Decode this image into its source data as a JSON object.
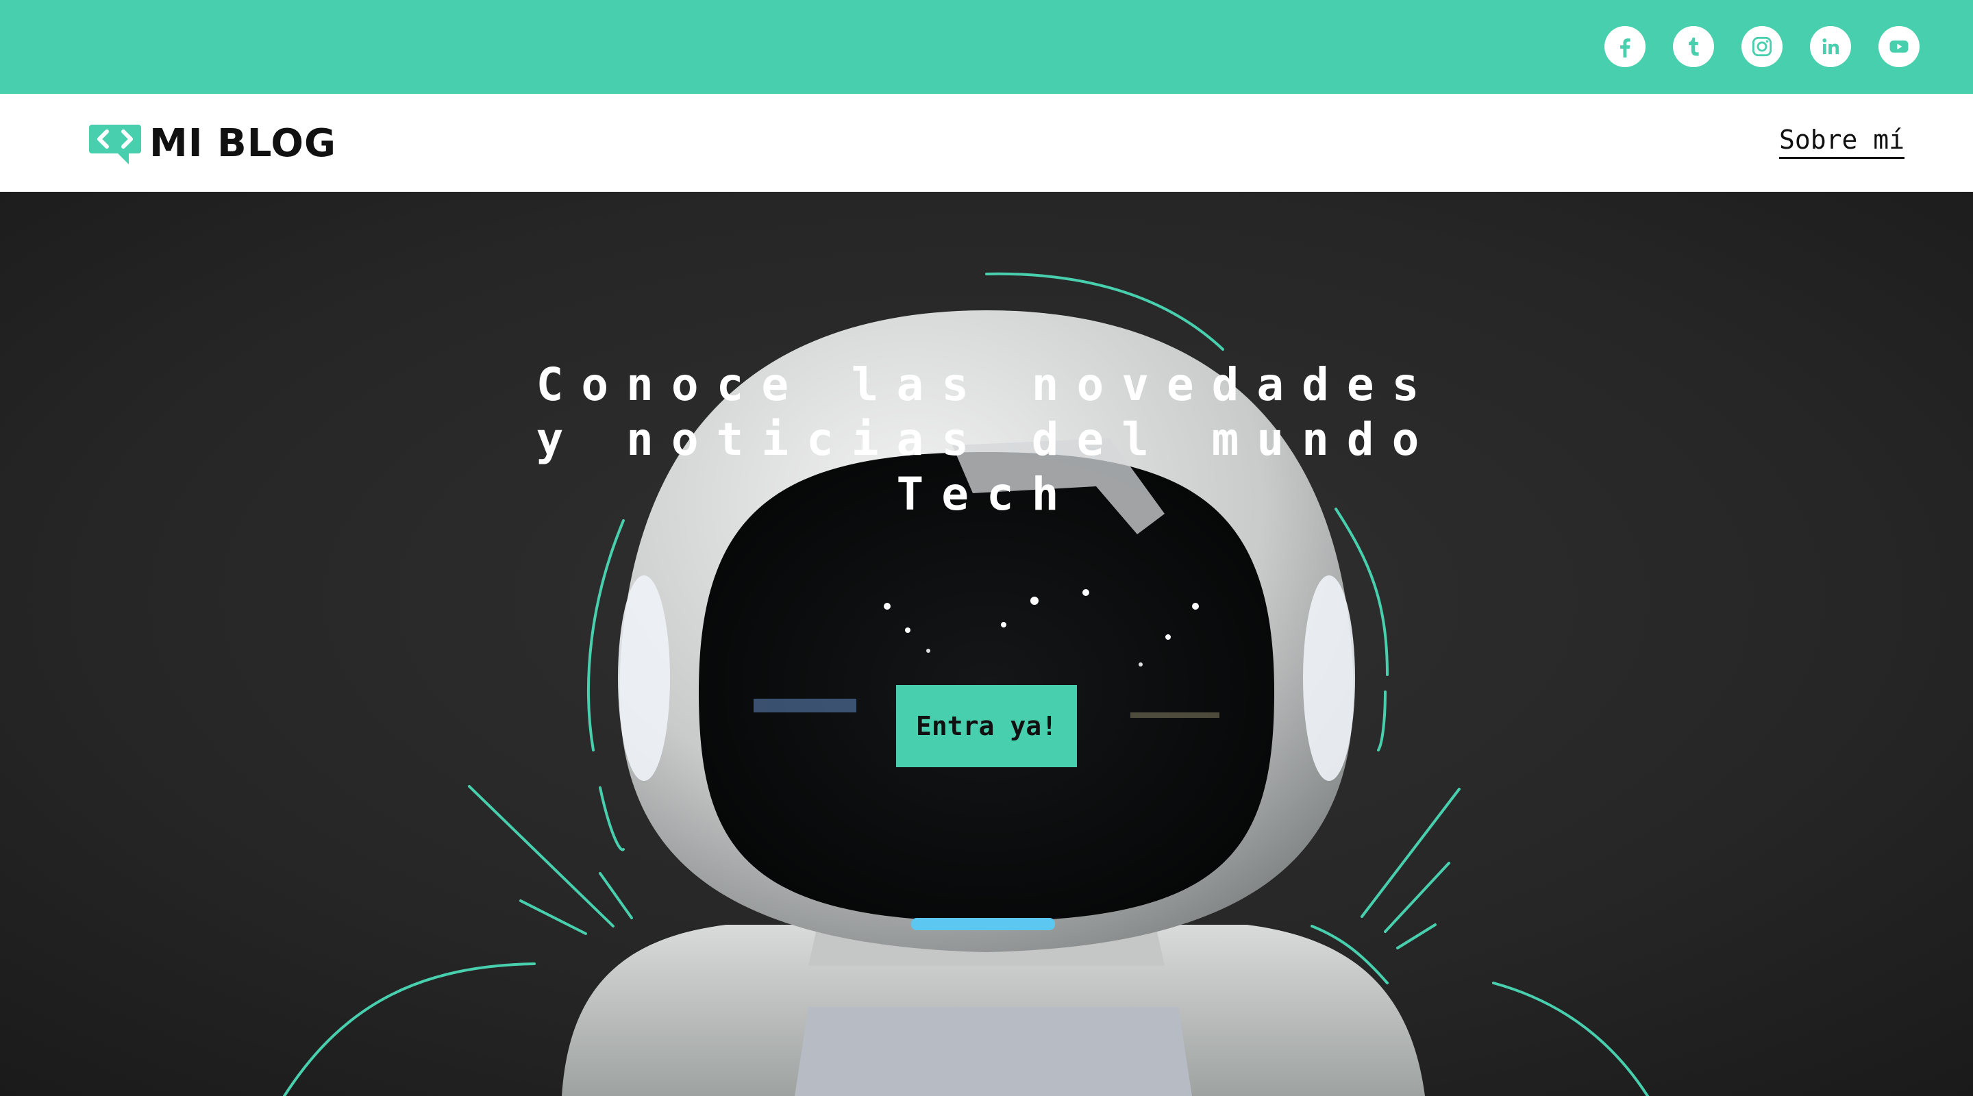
{
  "colors": {
    "accent": "#48cfad",
    "dark": "#242424",
    "text": "#111111",
    "white": "#ffffff"
  },
  "social": [
    {
      "name": "facebook",
      "icon": "facebook-icon"
    },
    {
      "name": "tumblr",
      "icon": "tumblr-icon"
    },
    {
      "name": "instagram",
      "icon": "instagram-icon"
    },
    {
      "name": "linkedin",
      "icon": "linkedin-icon"
    },
    {
      "name": "youtube",
      "icon": "youtube-icon"
    }
  ],
  "header": {
    "logo_icon": "code-chat-bubble-icon",
    "logo_text": "MI BLOG",
    "nav_link": "Sobre mí"
  },
  "hero": {
    "image": "astronaut-robot-helmet-photo",
    "title": "Conoce las novedades y noticias del mundo Tech",
    "cta_label": "Entra ya!"
  }
}
